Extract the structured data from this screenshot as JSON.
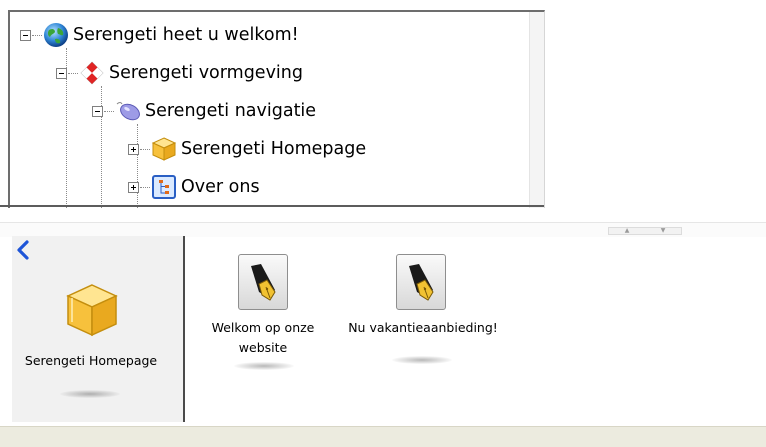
{
  "tree": {
    "nodes": [
      {
        "label": "Serengeti heet u welkom!",
        "icon": "globe-icon",
        "expander": "collapse"
      },
      {
        "label": "Serengeti vormgeving",
        "icon": "checker-cube-icon",
        "expander": "collapse"
      },
      {
        "label": "Serengeti navigatie",
        "icon": "mouse-icon",
        "expander": "collapse"
      },
      {
        "label": "Serengeti Homepage",
        "icon": "box-icon",
        "expander": "expand"
      },
      {
        "label": "Over ons",
        "icon": "page-hierarchy-icon",
        "expander": "expand"
      }
    ]
  },
  "detail": {
    "current_page_label": "Serengeti Homepage",
    "current_page_icon": "box-icon",
    "back_icon": "back-arrow-icon",
    "items": [
      {
        "label_line1": "Welkom op onze",
        "label_line2": "website",
        "icon": "pen-icon"
      },
      {
        "label_line1": "Nu vakantieaanbieding!",
        "label_line2": "",
        "icon": "pen-icon"
      }
    ]
  },
  "colors": {
    "accent_blue": "#1e55d8",
    "box_yellow": "#f5c33b",
    "status_bar": "#ecebdf"
  }
}
